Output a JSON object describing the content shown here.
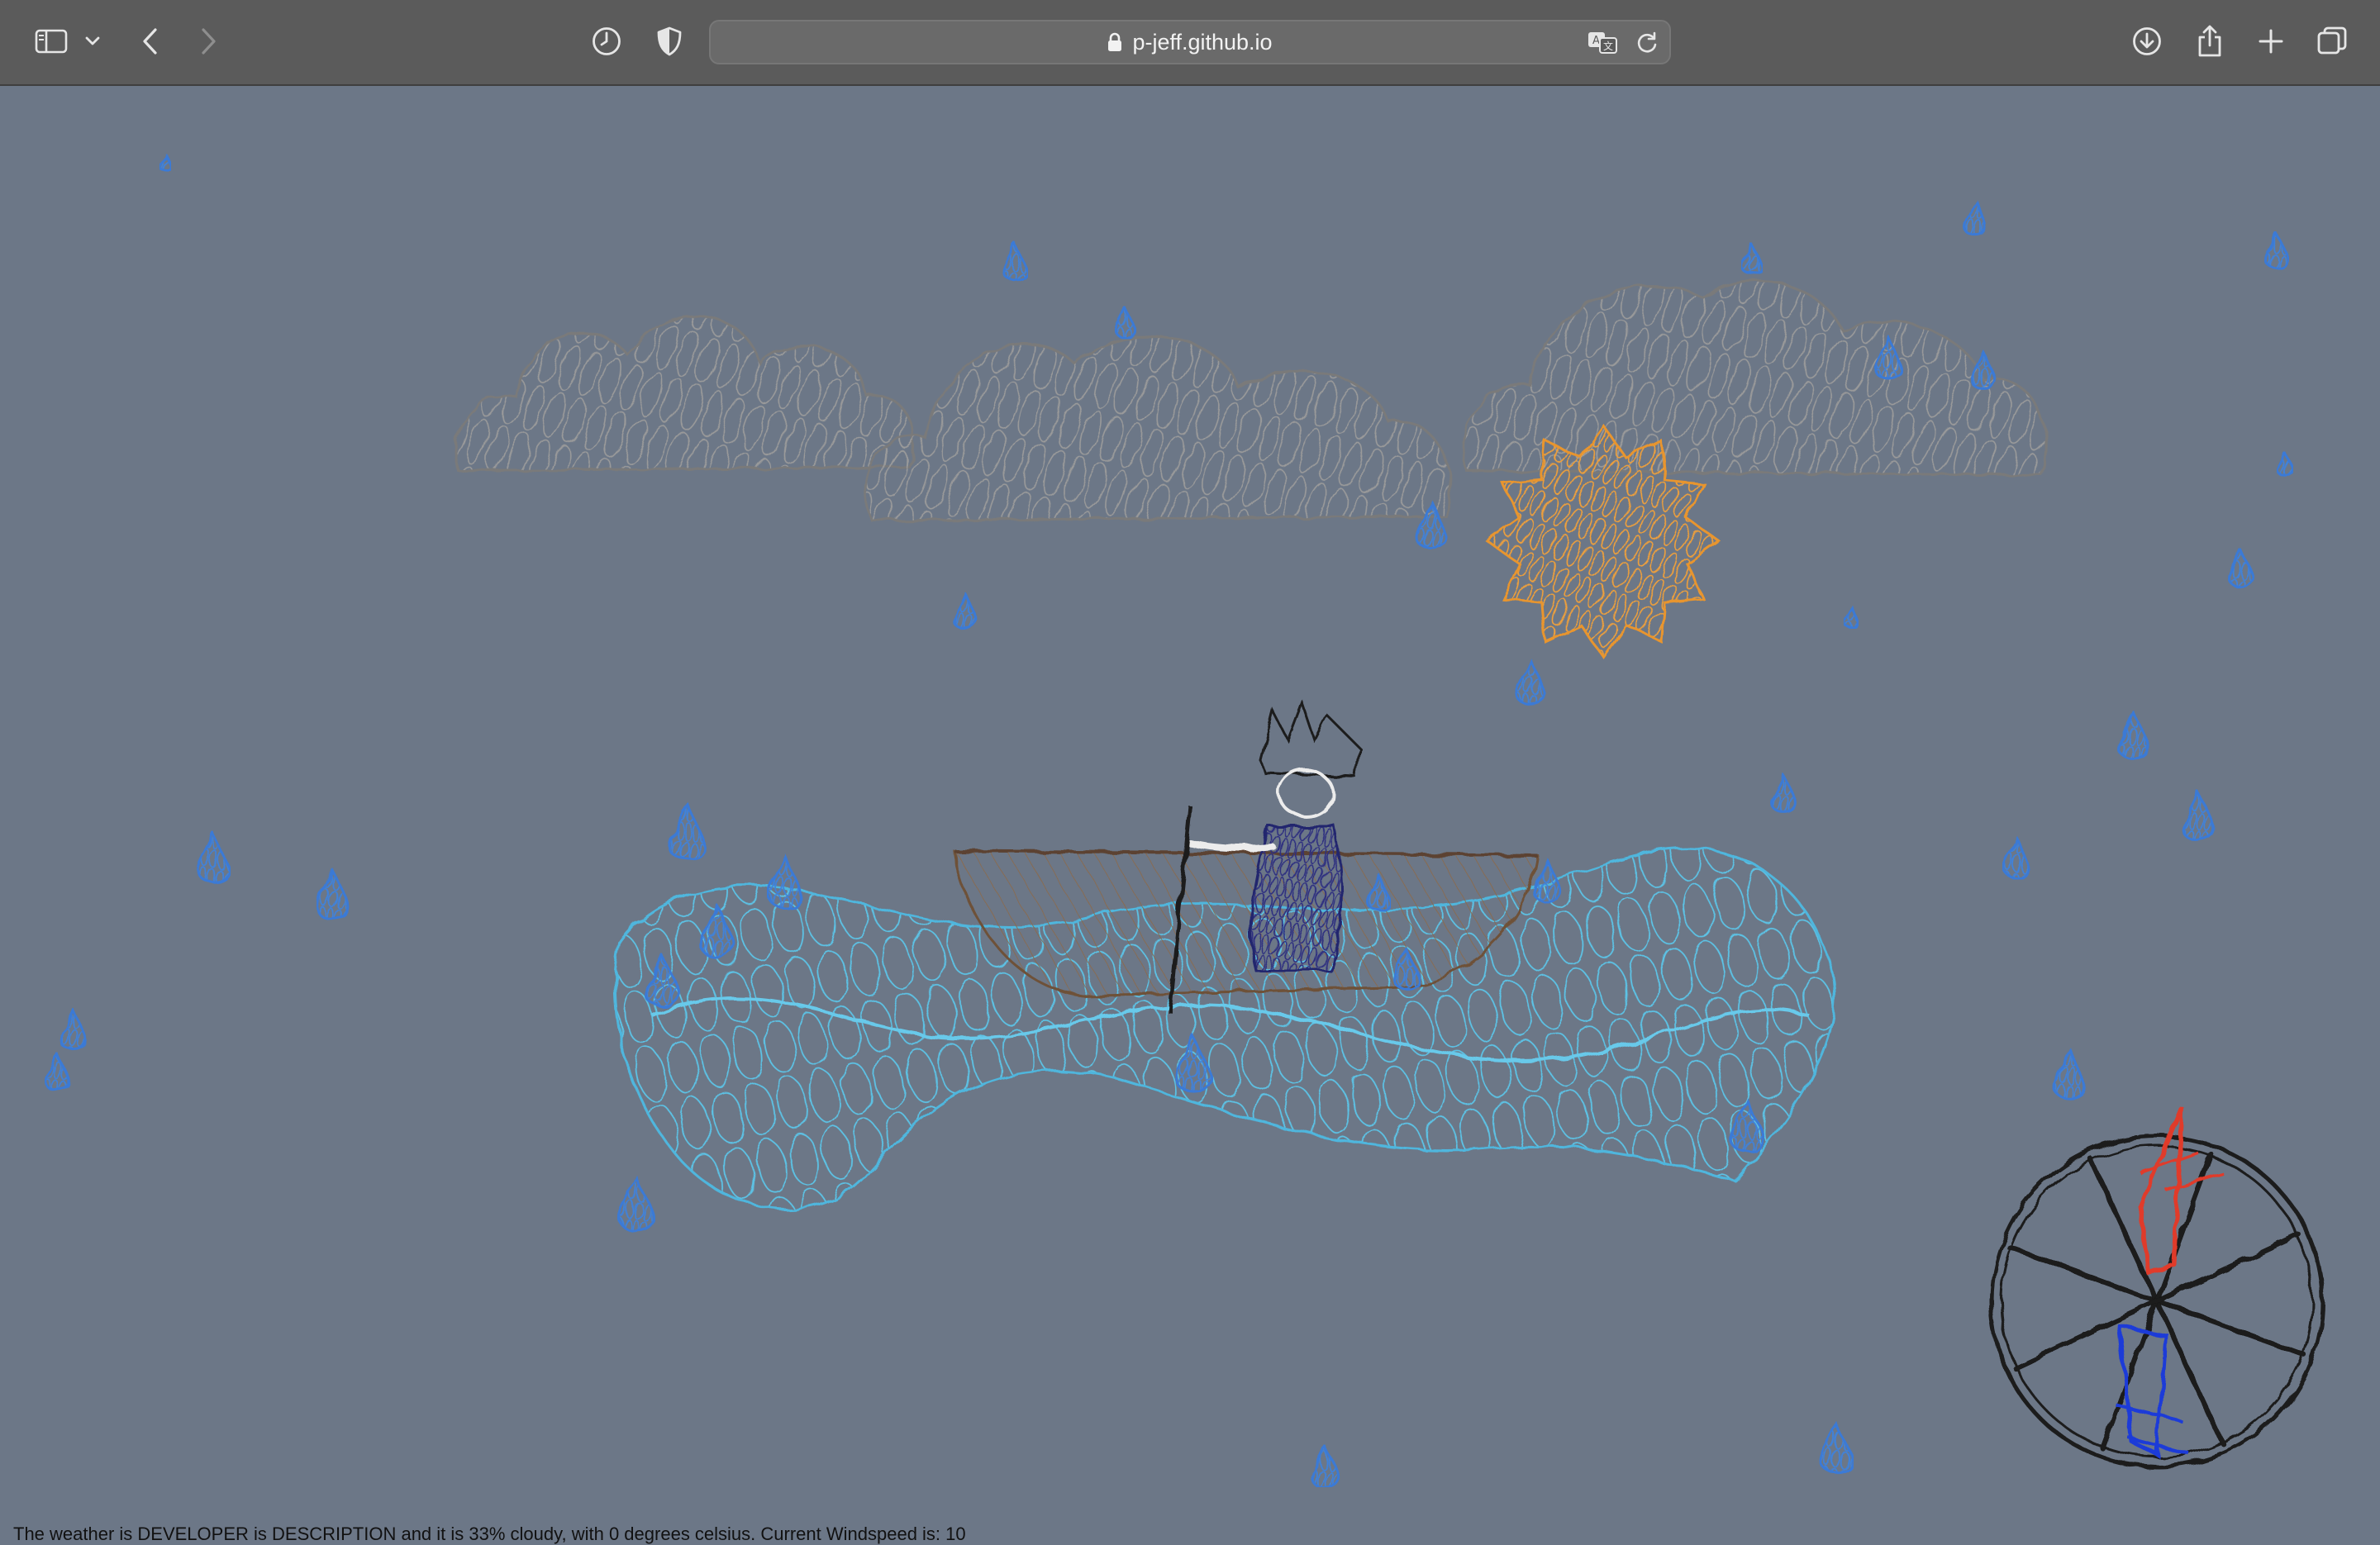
{
  "browser": {
    "url": "p-jeff.github.io",
    "icons": {
      "sidebar": "sidebar-icon",
      "sidebar_menu": "chevron-down-icon",
      "back": "chevron-left-icon",
      "forward": "chevron-right-icon",
      "history": "clock-icon",
      "privacy": "shield-icon",
      "secure": "lock-icon",
      "translate": "translate-icon",
      "reload": "reload-icon",
      "downloads": "download-icon",
      "share": "share-icon",
      "new_tab": "plus-icon",
      "tabs": "tabs-overview-icon"
    }
  },
  "page": {
    "weather_text": "The weather is DEVELOPER is DESCRIPTION and it is 33% cloudy, with 0 degrees celsius. Current Windspeed is: 10",
    "colors": {
      "sky": "#6c7787",
      "cloud": "#8f8f8f",
      "sun": "#e8952e",
      "water": "#59bde0",
      "rain": "#3f7fd8",
      "boat": "#7a5e46",
      "compass_north": "#e03b2a",
      "compass_south": "#1f3bd8",
      "compass_ring": "#1a1a1a"
    }
  }
}
